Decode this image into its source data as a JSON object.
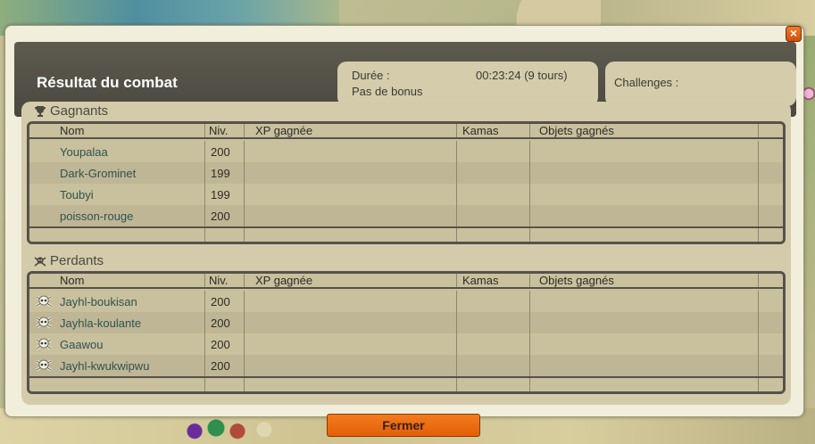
{
  "window": {
    "title": "Résultat du combat",
    "close_glyph": "×"
  },
  "info": {
    "duration_label": "Durée :",
    "duration_value": "00:23:24 (9 tours)",
    "bonus_label": "Pas de bonus",
    "challenges_label": "Challenges :"
  },
  "columns": {
    "name": "Nom",
    "level": "Niv.",
    "xp": "XP gagnée",
    "kamas": "Kamas",
    "objects": "Objets gagnés"
  },
  "winners": {
    "label": "Gagnants",
    "icon": "trophy-icon",
    "players": [
      {
        "name": "Youpalaa",
        "level": "200"
      },
      {
        "name": "Dark-Grominet",
        "level": "199"
      },
      {
        "name": "Toubyi",
        "level": "199"
      },
      {
        "name": "poisson-rouge",
        "level": "200"
      }
    ]
  },
  "losers": {
    "label": "Perdants",
    "icon": "skull-crossbones-icon",
    "players": [
      {
        "name": "Jayhl-boukisan",
        "level": "200",
        "status_icon": "skull-icon"
      },
      {
        "name": "Jayhla-koulante",
        "level": "200",
        "status_icon": "skull-icon"
      },
      {
        "name": "Gaawou",
        "level": "200",
        "status_icon": "skull-icon"
      },
      {
        "name": "Jayhl-kwukwipwu",
        "level": "200",
        "status_icon": "skull-icon"
      }
    ]
  },
  "footer": {
    "close_label": "Fermer"
  },
  "colors": {
    "title_bar": "#4b4840",
    "accent_orange": "#e45f09",
    "name_text": "#2d5350"
  }
}
